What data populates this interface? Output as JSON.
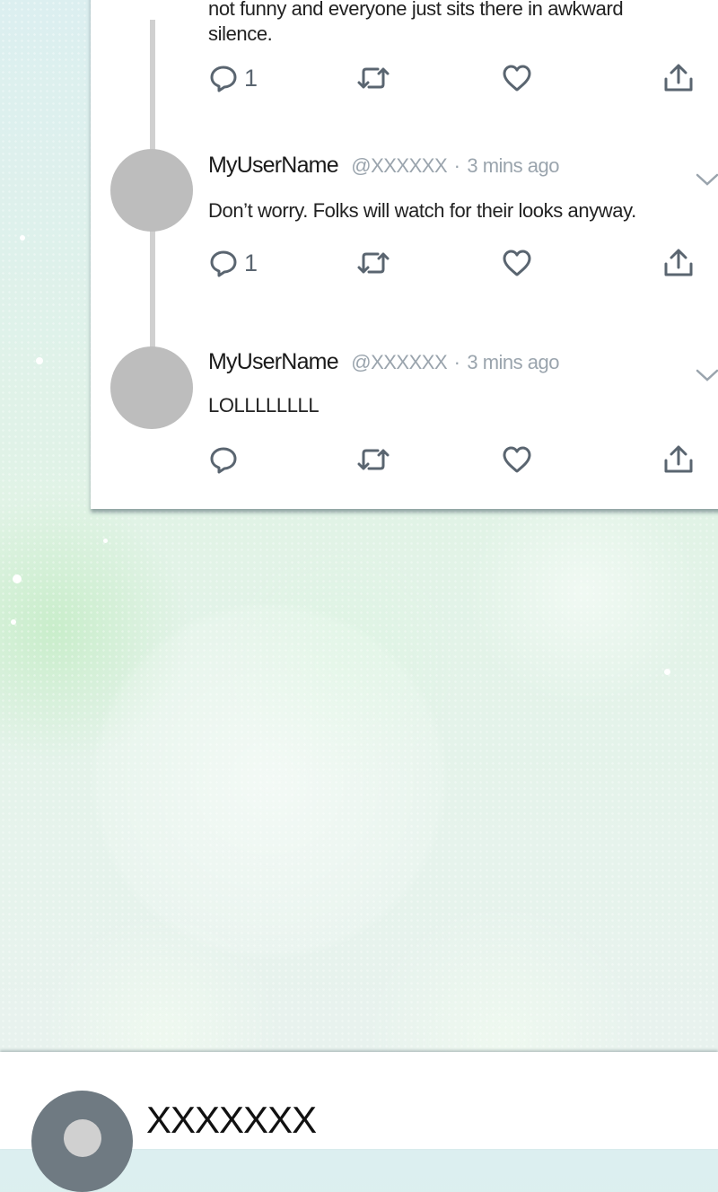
{
  "thread": {
    "partial_text": "not funny and everyone just sits there in awkward silence.",
    "partial_actions": {
      "reply_count": "1"
    },
    "replies": [
      {
        "username": "MyUserName",
        "handle": "@XXXXXX",
        "separator": "·",
        "time": "3 mins ago",
        "text": "Don’t worry. Folks will watch for their looks anyway.",
        "reply_count": "1"
      },
      {
        "username": "MyUserName",
        "handle": "@XXXXXX",
        "separator": "·",
        "time": "3 mins ago",
        "text": "LOLLLLLLLL",
        "reply_count": ""
      }
    ]
  },
  "profile": {
    "name": "XXXXXXX"
  },
  "icons": {
    "reply": "reply-bubble-icon",
    "retweet": "retweet-icon",
    "like": "heart-icon",
    "share": "share-upload-icon",
    "more": "chevron-down-icon"
  },
  "colors": {
    "icon": "#5a6570",
    "muted": "#9aa4ad",
    "avatar": "#bdbdbd",
    "profile_avatar": "#6f7a82"
  }
}
